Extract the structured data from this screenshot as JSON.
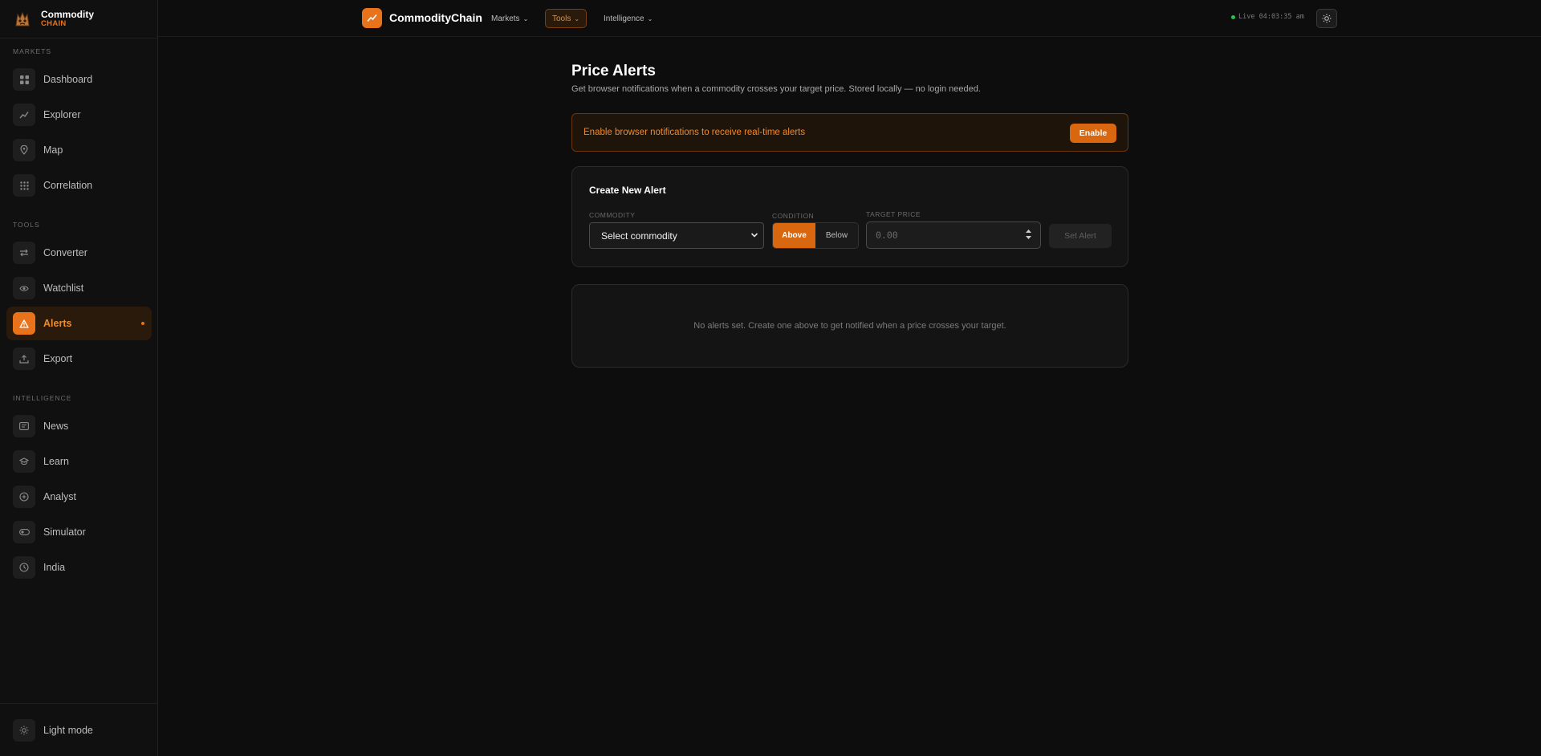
{
  "brand": {
    "name": "Commodity",
    "sub": "CHAIN"
  },
  "sidebar": {
    "sections": [
      {
        "label": "MARKETS",
        "items": [
          {
            "label": "Dashboard",
            "icon": "grid-icon"
          },
          {
            "label": "Explorer",
            "icon": "trend-icon"
          },
          {
            "label": "Map",
            "icon": "pin-icon"
          },
          {
            "label": "Correlation",
            "icon": "dots-grid-icon"
          }
        ]
      },
      {
        "label": "TOOLS",
        "items": [
          {
            "label": "Converter",
            "icon": "swap-icon"
          },
          {
            "label": "Watchlist",
            "icon": "eye-icon"
          },
          {
            "label": "Alerts",
            "icon": "warning-icon",
            "active": true
          },
          {
            "label": "Export",
            "icon": "upload-icon"
          }
        ]
      },
      {
        "label": "INTELLIGENCE",
        "items": [
          {
            "label": "News",
            "icon": "newspaper-icon"
          },
          {
            "label": "Learn",
            "icon": "graduation-cap-icon"
          },
          {
            "label": "Analyst",
            "icon": "plus-circle-icon"
          },
          {
            "label": "Simulator",
            "icon": "toggle-icon"
          },
          {
            "label": "India",
            "icon": "clock-icon"
          }
        ]
      }
    ],
    "footer": {
      "label": "Light mode",
      "icon": "sun-icon"
    }
  },
  "topbar": {
    "title": "CommodityChain",
    "menus": [
      "Markets",
      "Tools",
      "Intelligence"
    ],
    "active_menu": "Tools",
    "live_status": "Live 04:03:35 am"
  },
  "page": {
    "title": "Price Alerts",
    "subtitle": "Get browser notifications when a commodity crosses your target price. Stored locally — no login needed."
  },
  "banner": {
    "text": "Enable browser notifications to receive real-time alerts",
    "button": "Enable"
  },
  "create": {
    "title": "Create New Alert",
    "commodity_label": "COMMODITY",
    "commodity_value": "Select commodity",
    "condition_label": "CONDITION",
    "condition_options": [
      "Above",
      "Below"
    ],
    "condition_selected": "Above",
    "price_label": "TARGET PRICE",
    "price_placeholder": "0.00",
    "submit": "Set Alert"
  },
  "empty_state": "No alerts set. Create one above to get notified when a price crosses your target.",
  "colors": {
    "accent": "#e8731a",
    "background": "#0d0d0d",
    "live": "#27c24c"
  }
}
